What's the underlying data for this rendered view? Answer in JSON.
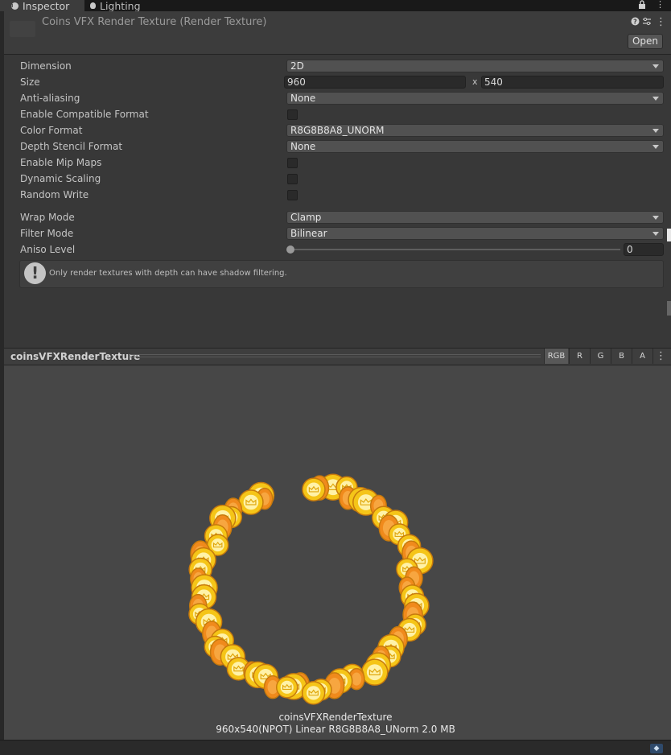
{
  "tabs": [
    {
      "label": "Inspector",
      "icon": "info-icon"
    },
    {
      "label": "Lighting",
      "icon": "lightbulb-icon"
    }
  ],
  "header": {
    "title": "Coins VFX Render Texture (Render Texture)",
    "open_label": "Open",
    "icons": [
      "help-icon",
      "settings-sliders-icon",
      "more-icon",
      "lock-icon"
    ]
  },
  "properties": {
    "dimension": {
      "label": "Dimension",
      "value": "2D"
    },
    "size": {
      "label": "Size",
      "width": "960",
      "separator": "x",
      "height": "540"
    },
    "anti_aliasing": {
      "label": "Anti-aliasing",
      "value": "None"
    },
    "enable_compatible_format": {
      "label": "Enable Compatible Format",
      "checked": false
    },
    "color_format": {
      "label": "Color Format",
      "value": "R8G8B8A8_UNORM"
    },
    "depth_stencil_format": {
      "label": "Depth Stencil Format",
      "value": "None"
    },
    "enable_mip_maps": {
      "label": "Enable Mip Maps",
      "checked": false
    },
    "dynamic_scaling": {
      "label": "Dynamic Scaling",
      "checked": false
    },
    "random_write": {
      "label": "Random Write",
      "checked": false
    },
    "wrap_mode": {
      "label": "Wrap Mode",
      "value": "Clamp"
    },
    "filter_mode": {
      "label": "Filter Mode",
      "value": "Bilinear"
    },
    "aniso_level": {
      "label": "Aniso Level",
      "value": "0",
      "slider_fraction": 0
    }
  },
  "help": {
    "text": "Only render textures with depth can have shadow filtering."
  },
  "preview": {
    "title": "coinsVFXRenderTexture",
    "channels": [
      "RGB",
      "R",
      "G",
      "B",
      "A"
    ],
    "active_channel": "RGB",
    "name": "coinsVFXRenderTexture",
    "info": "960x540(NPOT) Linear  R8G8B8A8_UNorm  2.0 MB"
  },
  "colors": {
    "coin_gold": "#f5c518",
    "coin_orange": "#f08a1c",
    "coin_highlight": "#fff2a8"
  }
}
